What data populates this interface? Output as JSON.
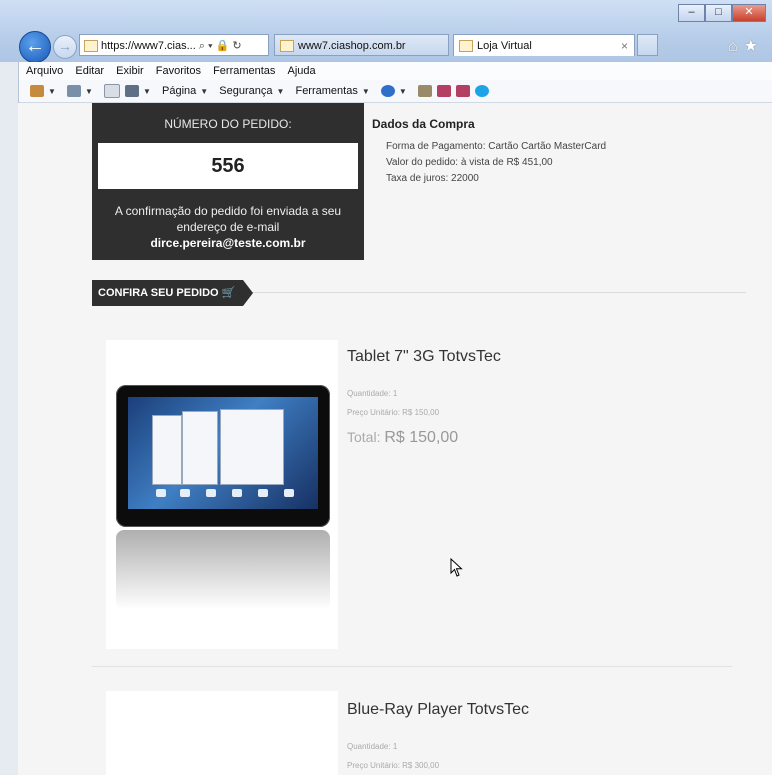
{
  "browser": {
    "address_url": "https://www7.cias...",
    "address_tools": "⌕ ▾ 🔒 ↻",
    "tabs": [
      {
        "label": "www7.ciashop.com.br"
      },
      {
        "label": "Loja Virtual",
        "close": "×"
      }
    ],
    "window_controls": [
      "–",
      "□",
      "✕"
    ],
    "nav_right_icons": "⌂★"
  },
  "menu": [
    "Arquivo",
    "Editar",
    "Exibir",
    "Favoritos",
    "Ferramentas",
    "Ajuda"
  ],
  "commandbar": {
    "pagina": "Página",
    "seguranca": "Segurança",
    "ferramentas": "Ferramentas"
  },
  "order": {
    "label": "NÚMERO DO PEDIDO:",
    "number": "556",
    "message": "A confirmação do pedido foi enviada a seu endereço de e-mail",
    "email": "dirce.pereira@teste.com.br"
  },
  "dados": {
    "title": "Dados da Compra",
    "lines": [
      "Forma de Pagamento: Cartão Cartão MasterCard",
      "Valor do pedido: à vista de R$ 451,00",
      "Taxa de juros: 22000"
    ]
  },
  "section": {
    "title": "CONFIRA SEU PEDIDO"
  },
  "products": [
    {
      "name": "Tablet 7\" 3G TotvsTec",
      "quantity": "Quantidade: 1",
      "unit_price": "Preço Unitário: R$ 150,00",
      "total_label": "Total:",
      "total_value": "R$ 150,00"
    },
    {
      "name": "Blue-Ray Player TotvsTec",
      "quantity": "Quantidade: 1",
      "unit_price": "Preço Unitário: R$ 300,00"
    }
  ]
}
